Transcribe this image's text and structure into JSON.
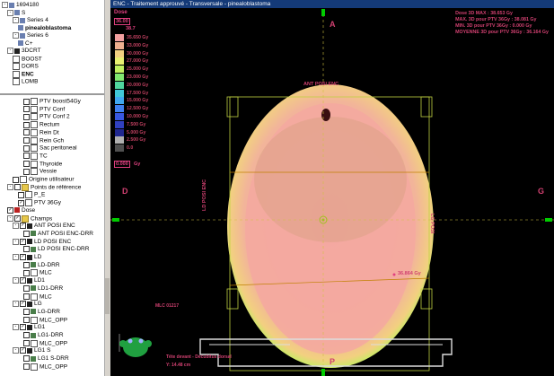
{
  "tree_top": [
    {
      "label": "1694180",
      "indent": 0,
      "icon": "img",
      "toggle": "-"
    },
    {
      "label": "S",
      "indent": 1,
      "icon": "img",
      "toggle": "-"
    },
    {
      "label": "Series 4",
      "indent": 2,
      "icon": "img",
      "toggle": "-"
    },
    {
      "label": "pinealoblastoma",
      "indent": 3,
      "icon": "img",
      "bold": true
    },
    {
      "label": "Series 6",
      "indent": 2,
      "icon": "img",
      "toggle": "-"
    },
    {
      "label": "C+",
      "indent": 3,
      "icon": "img"
    },
    {
      "label": "3DCRT",
      "indent": 1,
      "icon": "beam",
      "toggle": "-"
    },
    {
      "label": "BOOST",
      "indent": 2,
      "icon": "sq"
    },
    {
      "label": "DORS",
      "indent": 2,
      "icon": "sq"
    },
    {
      "label": "ENC",
      "indent": 2,
      "icon": "sq",
      "bold": true
    },
    {
      "label": "LOMB",
      "indent": 2,
      "icon": "sq"
    }
  ],
  "tree_bottom": [
    {
      "label": "PTV boost54Gy",
      "indent": 4,
      "check": "",
      "icon": "sq"
    },
    {
      "label": "PTV Conf",
      "indent": 4,
      "check": "",
      "icon": "sq"
    },
    {
      "label": "PTV Conf 2",
      "indent": 4,
      "check": "",
      "icon": "sq"
    },
    {
      "label": "Rectum",
      "indent": 4,
      "check": "",
      "icon": "sq"
    },
    {
      "label": "Rein Dt",
      "indent": 4,
      "check": "",
      "icon": "sq"
    },
    {
      "label": "Rein Gch",
      "indent": 4,
      "check": "",
      "icon": "sq"
    },
    {
      "label": "Sac peritoneal",
      "indent": 4,
      "check": "",
      "icon": "sq"
    },
    {
      "label": "TC",
      "indent": 4,
      "check": "",
      "icon": "sq"
    },
    {
      "label": "Thyroide",
      "indent": 4,
      "check": "",
      "icon": "sq"
    },
    {
      "label": "Vessie",
      "indent": 4,
      "check": "",
      "icon": "sq"
    },
    {
      "label": "Origine utilisateur",
      "indent": 2,
      "check": "",
      "icon": "sq"
    },
    {
      "label": "Points de référence",
      "indent": 1,
      "toggle": "-",
      "check": "",
      "icon": "folder"
    },
    {
      "label": "P_E",
      "indent": 3,
      "check": "",
      "icon": "sq"
    },
    {
      "label": "PTV 36Gy",
      "indent": 3,
      "check": "✓",
      "icon": "sq"
    },
    {
      "label": "Dose",
      "indent": 1,
      "check": "✓",
      "icon": "dose"
    },
    {
      "label": "Champs",
      "indent": 1,
      "toggle": "-",
      "check": "✓",
      "icon": "folder"
    },
    {
      "label": "ANT POSI ENC",
      "indent": 2,
      "toggle": "-",
      "check": "✓",
      "icon": "beam"
    },
    {
      "label": "ANT POSI ENC-DRR",
      "indent": 4,
      "check": "",
      "icon": "drr"
    },
    {
      "label": "LD POSI ENC",
      "indent": 2,
      "toggle": "-",
      "check": "✓",
      "icon": "beam"
    },
    {
      "label": "LD POSI ENC-DRR",
      "indent": 4,
      "check": "",
      "icon": "drr"
    },
    {
      "label": "LD",
      "indent": 2,
      "toggle": "-",
      "check": "✓",
      "icon": "beam"
    },
    {
      "label": "LD-DRR",
      "indent": 4,
      "check": "",
      "icon": "drr"
    },
    {
      "label": "MLC",
      "indent": 4,
      "check": "",
      "icon": "sq"
    },
    {
      "label": "LD1",
      "indent": 2,
      "toggle": "-",
      "check": "✓",
      "icon": "beam"
    },
    {
      "label": "LD1-DRR",
      "indent": 4,
      "check": "",
      "icon": "drr"
    },
    {
      "label": "MLC",
      "indent": 4,
      "check": "",
      "icon": "sq"
    },
    {
      "label": "LG",
      "indent": 2,
      "toggle": "-",
      "check": "✓",
      "icon": "beam"
    },
    {
      "label": "LG-DRR",
      "indent": 4,
      "check": "",
      "icon": "drr"
    },
    {
      "label": "MLC_OPP",
      "indent": 4,
      "check": "",
      "icon": "sq"
    },
    {
      "label": "LG1",
      "indent": 2,
      "toggle": "-",
      "check": "✓",
      "icon": "beam"
    },
    {
      "label": "LG1-DRR",
      "indent": 4,
      "check": "",
      "icon": "drr"
    },
    {
      "label": "MLC_OPP",
      "indent": 4,
      "check": "",
      "icon": "sq"
    },
    {
      "label": "LG1 S",
      "indent": 2,
      "toggle": "-",
      "check": "✓",
      "icon": "beam"
    },
    {
      "label": "LG1 S-DRR",
      "indent": 4,
      "check": "",
      "icon": "drr"
    },
    {
      "label": "MLC_OPP",
      "indent": 4,
      "check": "",
      "icon": "sq"
    }
  ],
  "viewer": {
    "title": "ENC - Traitement approuvé - Transversale - pinealoblastoma",
    "dose_header": "Dose",
    "dose_ref": "36.00",
    "dose_top": "38.7",
    "legend": [
      {
        "label": "35.650 Gy",
        "color": "#f2a0a0"
      },
      {
        "label": "33.000 Gy",
        "color": "#f0b090"
      },
      {
        "label": "30.000 Gy",
        "color": "#f2d080"
      },
      {
        "label": "27.000 Gy",
        "color": "#e8f070"
      },
      {
        "label": "25.000 Gy",
        "color": "#c0f060"
      },
      {
        "label": "23.000 Gy",
        "color": "#80e870"
      },
      {
        "label": "20.000 Gy",
        "color": "#50d8a0"
      },
      {
        "label": "17.500 Gy",
        "color": "#40c8d8"
      },
      {
        "label": "15.000 Gy",
        "color": "#40a8f0"
      },
      {
        "label": "12.500 Gy",
        "color": "#4080f0"
      },
      {
        "label": "10.000 Gy",
        "color": "#3858e0"
      },
      {
        "label": "7.500 Gy",
        "color": "#3040c0"
      },
      {
        "label": "5.000 Gy",
        "color": "#202890"
      },
      {
        "label": "2.500 Gy",
        "color": "#b0b0b0"
      },
      {
        "label": "0.0",
        "color": "#505050"
      }
    ],
    "cursor_dose": "0.000",
    "cursor_unit": "Gy",
    "stats": [
      "Dose 3D MAX : 38.653 Gy",
      "MAX. 3D pour PTV 36Gy : 38.081 Gy",
      "MIN. 3D pour PTV 36Gy : 0.000 Gy",
      "MOYENNE 3D pour PTV 36Gy : 36.164 Gy"
    ],
    "orient_top": "A",
    "orient_bottom": "P",
    "orient_left": "D",
    "orient_right": "G",
    "beam_top_label": "ANT POSI ENC",
    "beam_left_label": "LD POSI ENC",
    "beam_right_label": "LG POSI",
    "point_label": "36.864 Gy",
    "mlc_label": "MLC 01217",
    "bottom_line1": "Tête devant - Décubitus dorsal",
    "bottom_line2": "Y: 14.48 cm"
  },
  "colors": {
    "title_bg": "#143a78",
    "accent": "#d04070",
    "marker": "#00cc00"
  }
}
